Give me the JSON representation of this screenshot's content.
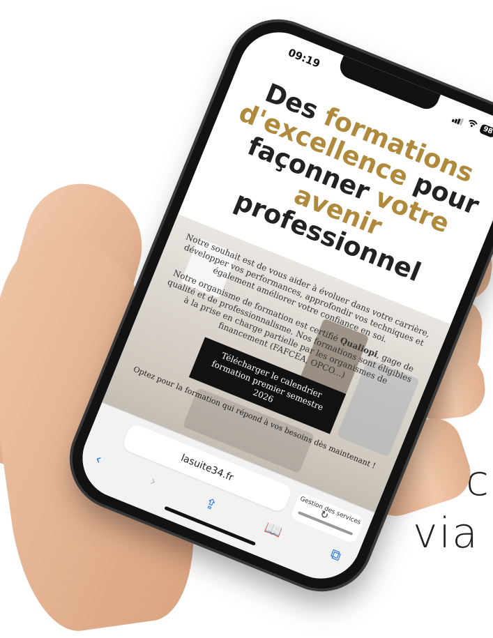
{
  "status": {
    "time": "09:19",
    "battery": "98"
  },
  "hero": {
    "title_line1_dark": "Des ",
    "title_line1_gold": "formations",
    "title_line2_gold": "d'excellence",
    "title_line2_dark": " pour",
    "title_line3_dark": "façonner ",
    "title_line3_gold": "votre",
    "title_line4_gold": "avenir",
    "title_line5_dark": "professionnel",
    "paragraph1": "Notre souhait est de vous aider à évoluer dans votre carrière, développer vos performances, approfondir vos techniques et également améliorer votre confiance en soi.",
    "paragraph2_before": "Notre organisme de formation est certifié ",
    "paragraph2_bold": "Qualiopi",
    "paragraph2_after": ", gage de qualité et de professionnalisme. Nos formations sont éligibles à la prise en charge partielle par les organismes de financement (FAFCEA, OPCO...)",
    "cta_label": "Télécharger le calendrier formation premier semestre 2026",
    "offer_text": "Optez pour la formation qui répond à vos besoins dès maintenant !"
  },
  "browser": {
    "url": "lasuite34.fr",
    "tab_label": "Gestion des services",
    "icons": {
      "back": "chevron-left-icon",
      "forward": "chevron-right-icon",
      "share": "share-icon",
      "bookmarks": "book-icon",
      "tabs": "tabs-icon",
      "reload": "reload-icon",
      "reader": "reader-icon"
    }
  },
  "outside_text": {
    "line1": "c",
    "line2": "via"
  },
  "colors": {
    "accent_gold": "#b08a3c",
    "link_blue": "#1a73e8"
  }
}
